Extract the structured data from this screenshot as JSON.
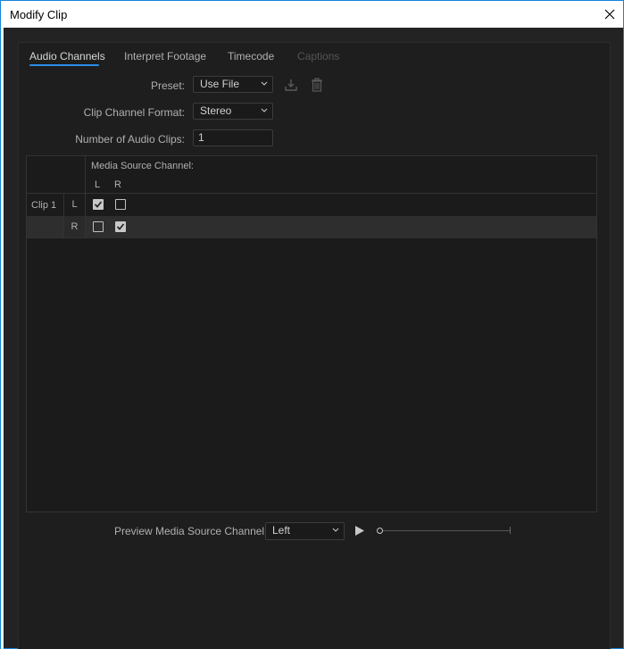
{
  "window": {
    "title": "Modify Clip",
    "close_glyph": "close-icon"
  },
  "tabs": [
    {
      "label": "Audio Channels",
      "state": "active"
    },
    {
      "label": "Interpret Footage",
      "state": "normal"
    },
    {
      "label": "Timecode",
      "state": "normal"
    },
    {
      "label": "Captions",
      "state": "disabled"
    }
  ],
  "form": {
    "preset_label": "Preset:",
    "preset_value": "Use File",
    "clip_channel_format_label": "Clip Channel Format:",
    "clip_channel_format_value": "Stereo",
    "num_audio_clips_label": "Number of Audio Clips:",
    "num_audio_clips_value": "1"
  },
  "grid": {
    "header": "Media Source Channel:",
    "columns": [
      "L",
      "R"
    ],
    "clip_label": "Clip 1",
    "rows": [
      {
        "channel": "L",
        "checks": [
          true,
          false
        ]
      },
      {
        "channel": "R",
        "checks": [
          false,
          true
        ]
      }
    ]
  },
  "preview": {
    "label": "Preview Media Source Channel:",
    "value": "Left",
    "progress": 0
  },
  "colors": {
    "accent": "#2d8ceb",
    "panel_bg": "#1e1e1e",
    "text": "#b0b0b0"
  }
}
